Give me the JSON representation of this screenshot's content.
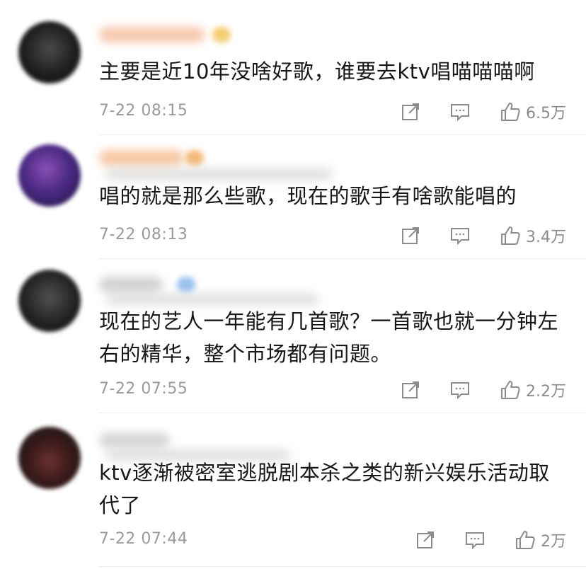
{
  "comments": [
    {
      "text": "主要是近10年没啥好歌，谁要去ktv唱喵喵喵啊",
      "time": "7-22 08:15",
      "likes": "6.5万",
      "avatar_colors": [
        "#3a3a3a",
        "#111111"
      ],
      "name_color": "#f4b08a"
    },
    {
      "text": "唱的就是那么些歌，现在的歌手有啥歌能唱的",
      "time": "7-22 08:13",
      "likes": "3.4万",
      "avatar_colors": [
        "#7a3fa0",
        "#2a1a5a"
      ],
      "name_color": "#f5b07e"
    },
    {
      "text": "现在的艺人一年能有几首歌？一首歌也就一分钟左右的精华，整个市场都有问题。",
      "time": "7-22 07:55",
      "likes": "2.2万",
      "avatar_colors": [
        "#444444",
        "#151515"
      ],
      "name_color": "#b5b5b5"
    },
    {
      "text": "ktv逐渐被密室逃脱剧本杀之类的新兴娱乐活动取代了",
      "time": "7-22 07:44",
      "likes": "2万",
      "avatar_colors": [
        "#5a2a2a",
        "#1a1a1a"
      ],
      "name_color": "#bdbdbd"
    }
  ],
  "icons": {
    "share": "share-icon",
    "reply": "comment-icon",
    "like": "thumbs-up-icon"
  }
}
